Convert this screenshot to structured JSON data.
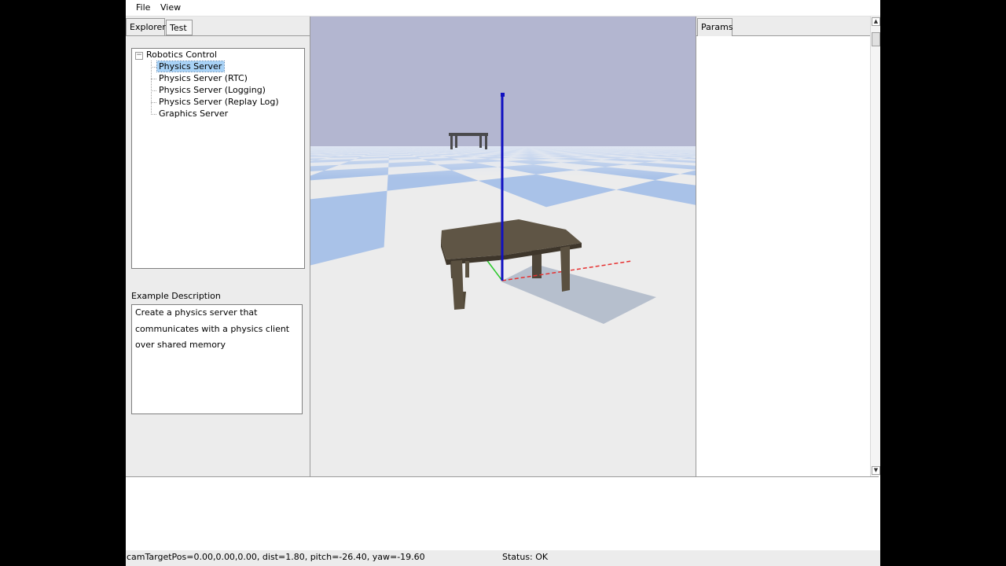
{
  "menu": {
    "file": "File",
    "view": "View"
  },
  "left_tabs": {
    "explorer": "Explorer",
    "test": "Test"
  },
  "tree": {
    "root": "Robotics Control",
    "items": [
      {
        "label": "Physics Server",
        "selected": true
      },
      {
        "label": "Physics Server (RTC)",
        "selected": false
      },
      {
        "label": "Physics Server (Logging)",
        "selected": false
      },
      {
        "label": "Physics Server (Replay Log)",
        "selected": false
      },
      {
        "label": "Graphics Server",
        "selected": false
      }
    ]
  },
  "description": {
    "label": "Example Description",
    "lines": [
      "Create a physics server that",
      "communicates with a physics client",
      "over shared memory"
    ]
  },
  "right_tabs": {
    "params": "Params"
  },
  "status": {
    "camera": "camTargetPos=0.00,0.00,0.00, dist=1.80, pitch=-26.40, yaw=-19.60",
    "state": "Status: OK"
  },
  "colors": {
    "sky": "#b3b6d0",
    "floor_light": "#ececec",
    "floor_blue": "#a9c2e8",
    "table": "#5e5444",
    "axis_x": "#e63232",
    "axis_y": "#28c828",
    "axis_z": "#1010c0"
  }
}
